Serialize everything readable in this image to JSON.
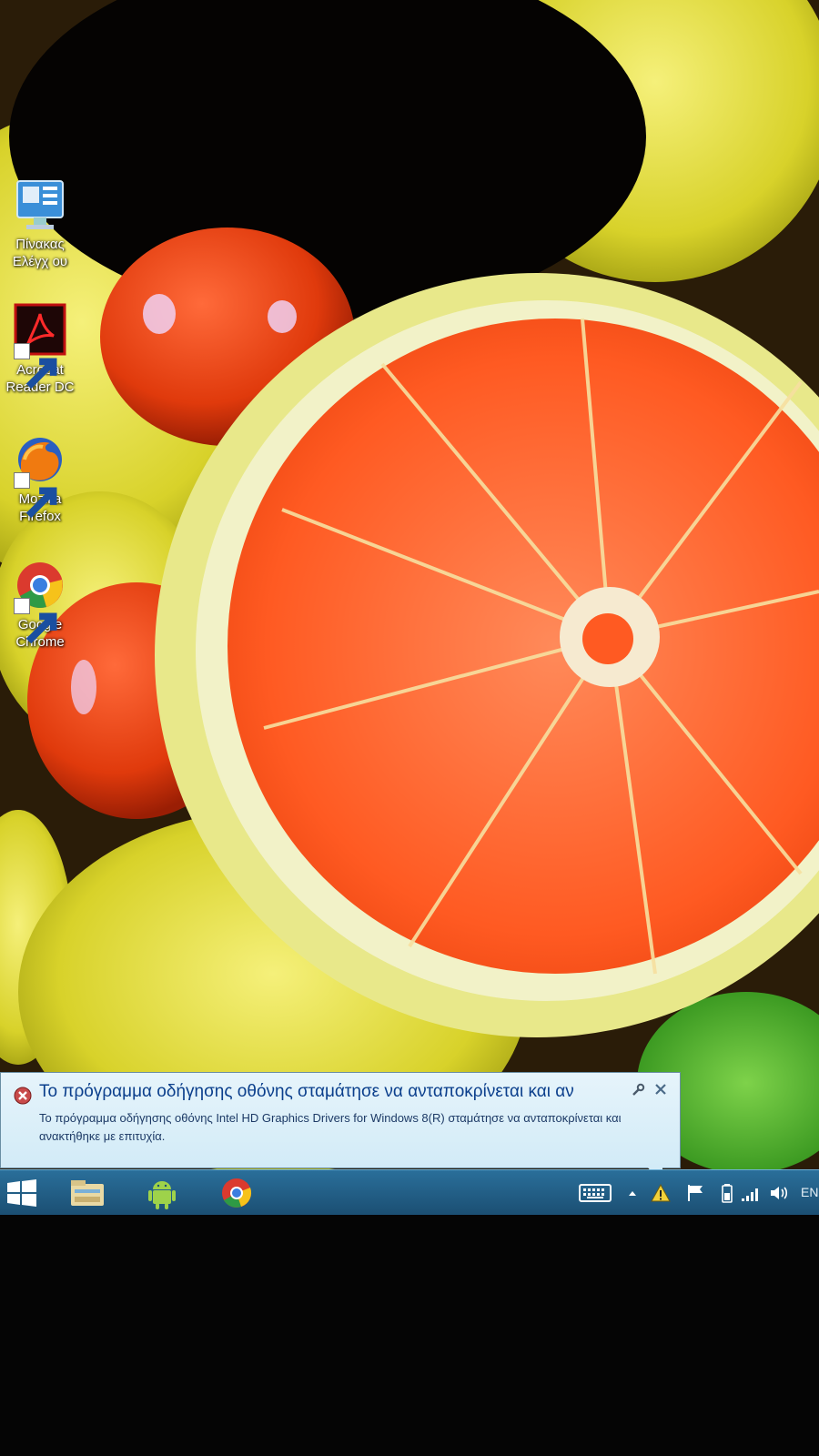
{
  "desktop": {
    "icons": [
      {
        "label": "Πίνακας Ελέγχ ου",
        "icon": "control-panel-icon"
      },
      {
        "label": "Acrobat Reader DC",
        "icon": "acrobat-icon"
      },
      {
        "label": "Mozilla Firefox",
        "icon": "firefox-icon"
      },
      {
        "label": "Google Chrome",
        "icon": "chrome-icon"
      }
    ]
  },
  "notification": {
    "title": "Το πρόγραμμα οδήγησης οθόνης σταμάτησε να ανταποκρίνεται και αν",
    "body": "Το πρόγραμμα οδήγησης οθόνης Intel HD Graphics Drivers for Windows 8(R) σταμάτησε να ανταποκρίνεται και ανακτήθηκε με επιτυχία.",
    "icon": "error-icon"
  },
  "taskbar": {
    "pinned": [
      "start-icon",
      "file-explorer-icon",
      "android-icon",
      "chrome-icon"
    ],
    "tray": [
      "keyboard-icon",
      "show-hidden-icon",
      "warning-icon",
      "flag-icon",
      "battery-icon",
      "signal-icon",
      "volume-icon"
    ],
    "language": "EN"
  },
  "colors": {
    "taskbar": "#1f5a82",
    "balloon": "#dcf0fa",
    "balloon_title": "#0b3f8c"
  }
}
